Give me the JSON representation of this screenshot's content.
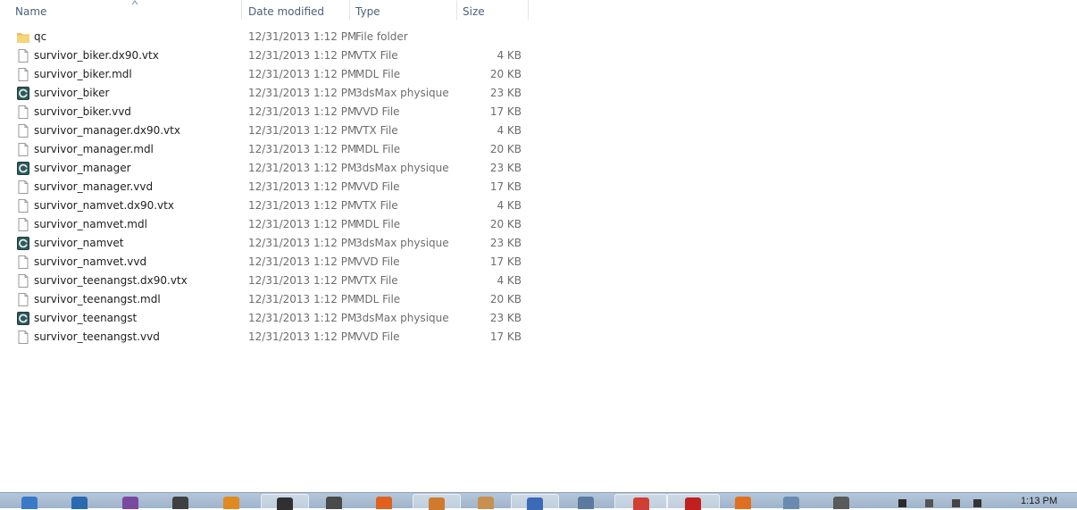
{
  "columns": {
    "name": "Name",
    "date_modified": "Date modified",
    "type": "Type",
    "size": "Size"
  },
  "files": [
    {
      "name": "qc",
      "date": "12/31/2013 1:12 PM",
      "type": "File folder",
      "size": "",
      "icon": "folder-icon"
    },
    {
      "name": "survivor_biker.dx90.vtx",
      "date": "12/31/2013 1:12 PM",
      "type": "VTX File",
      "size": "4 KB",
      "icon": "file-icon"
    },
    {
      "name": "survivor_biker.mdl",
      "date": "12/31/2013 1:12 PM",
      "type": "MDL File",
      "size": "20 KB",
      "icon": "file-icon"
    },
    {
      "name": "survivor_biker",
      "date": "12/31/2013 1:12 PM",
      "type": "3dsMax physique ...",
      "size": "23 KB",
      "icon": "3dsmax-icon"
    },
    {
      "name": "survivor_biker.vvd",
      "date": "12/31/2013 1:12 PM",
      "type": "VVD File",
      "size": "17 KB",
      "icon": "file-icon"
    },
    {
      "name": "survivor_manager.dx90.vtx",
      "date": "12/31/2013 1:12 PM",
      "type": "VTX File",
      "size": "4 KB",
      "icon": "file-icon"
    },
    {
      "name": "survivor_manager.mdl",
      "date": "12/31/2013 1:12 PM",
      "type": "MDL File",
      "size": "20 KB",
      "icon": "file-icon"
    },
    {
      "name": "survivor_manager",
      "date": "12/31/2013 1:12 PM",
      "type": "3dsMax physique ...",
      "size": "23 KB",
      "icon": "3dsmax-icon"
    },
    {
      "name": "survivor_manager.vvd",
      "date": "12/31/2013 1:12 PM",
      "type": "VVD File",
      "size": "17 KB",
      "icon": "file-icon"
    },
    {
      "name": "survivor_namvet.dx90.vtx",
      "date": "12/31/2013 1:12 PM",
      "type": "VTX File",
      "size": "4 KB",
      "icon": "file-icon"
    },
    {
      "name": "survivor_namvet.mdl",
      "date": "12/31/2013 1:12 PM",
      "type": "MDL File",
      "size": "20 KB",
      "icon": "file-icon"
    },
    {
      "name": "survivor_namvet",
      "date": "12/31/2013 1:12 PM",
      "type": "3dsMax physique ...",
      "size": "23 KB",
      "icon": "3dsmax-icon"
    },
    {
      "name": "survivor_namvet.vvd",
      "date": "12/31/2013 1:12 PM",
      "type": "VVD File",
      "size": "17 KB",
      "icon": "file-icon"
    },
    {
      "name": "survivor_teenangst.dx90.vtx",
      "date": "12/31/2013 1:12 PM",
      "type": "VTX File",
      "size": "4 KB",
      "icon": "file-icon"
    },
    {
      "name": "survivor_teenangst.mdl",
      "date": "12/31/2013 1:12 PM",
      "type": "MDL File",
      "size": "20 KB",
      "icon": "file-icon"
    },
    {
      "name": "survivor_teenangst",
      "date": "12/31/2013 1:12 PM",
      "type": "3dsMax physique ...",
      "size": "23 KB",
      "icon": "3dsmax-icon"
    },
    {
      "name": "survivor_teenangst.vvd",
      "date": "12/31/2013 1:12 PM",
      "type": "VVD File",
      "size": "17 KB",
      "icon": "file-icon"
    }
  ],
  "taskbar": {
    "clock": "1:13 PM",
    "buttons": [
      {
        "name": "explorer-icon",
        "color": "#3a78c8",
        "active": false
      },
      {
        "name": "pinned-app-1-icon",
        "color": "#2a6ab0",
        "active": false
      },
      {
        "name": "pinned-app-2-icon",
        "color": "#7a4aa0",
        "active": false
      },
      {
        "name": "pinned-app-3-icon",
        "color": "#404040",
        "active": false
      },
      {
        "name": "pinned-app-4-icon",
        "color": "#e08a20",
        "active": false
      },
      {
        "name": "pinned-app-5-icon",
        "color": "#303030",
        "active": true
      },
      {
        "name": "pinned-app-6-icon",
        "color": "#4a4a4a",
        "active": false
      },
      {
        "name": "pinned-app-7-icon",
        "color": "#e06020",
        "active": false
      },
      {
        "name": "pinned-app-8-icon",
        "color": "#d07a30",
        "active": true
      },
      {
        "name": "pinned-app-9-icon",
        "color": "#c89050",
        "active": false
      },
      {
        "name": "pinned-app-10-icon",
        "color": "#3a6ab8",
        "active": true
      },
      {
        "name": "pinned-app-11-icon",
        "color": "#5a7aa0",
        "active": false
      },
      {
        "name": "chrome-icon",
        "color": "#d04030",
        "active": true
      },
      {
        "name": "pinned-app-13-icon",
        "color": "#c02020",
        "active": true
      },
      {
        "name": "firefox-icon",
        "color": "#e07020",
        "active": false
      },
      {
        "name": "pinned-app-15-icon",
        "color": "#6a8ab0",
        "active": false
      },
      {
        "name": "pinned-app-16-icon",
        "color": "#5a5a5a",
        "active": false
      }
    ]
  }
}
